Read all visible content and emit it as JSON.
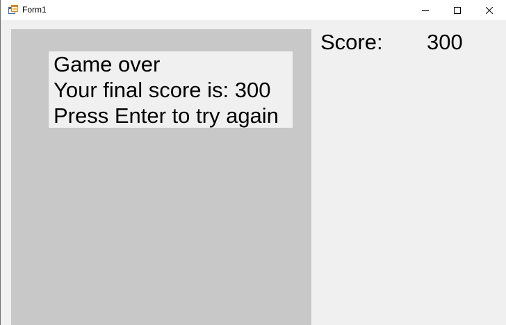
{
  "window": {
    "title": "Form1",
    "controls": {
      "minimize_icon": "minimize-icon",
      "maximize_icon": "maximize-icon",
      "close_icon": "close-icon"
    }
  },
  "game": {
    "message_lines": [
      "Game over",
      "Your final score is: 300",
      "Press Enter to try again"
    ]
  },
  "scoreboard": {
    "label": "Score:",
    "value": "300"
  },
  "colors": {
    "form_background": "#f0f0f0",
    "game_panel": "#c8c8c8",
    "title_bar": "#ffffff"
  }
}
